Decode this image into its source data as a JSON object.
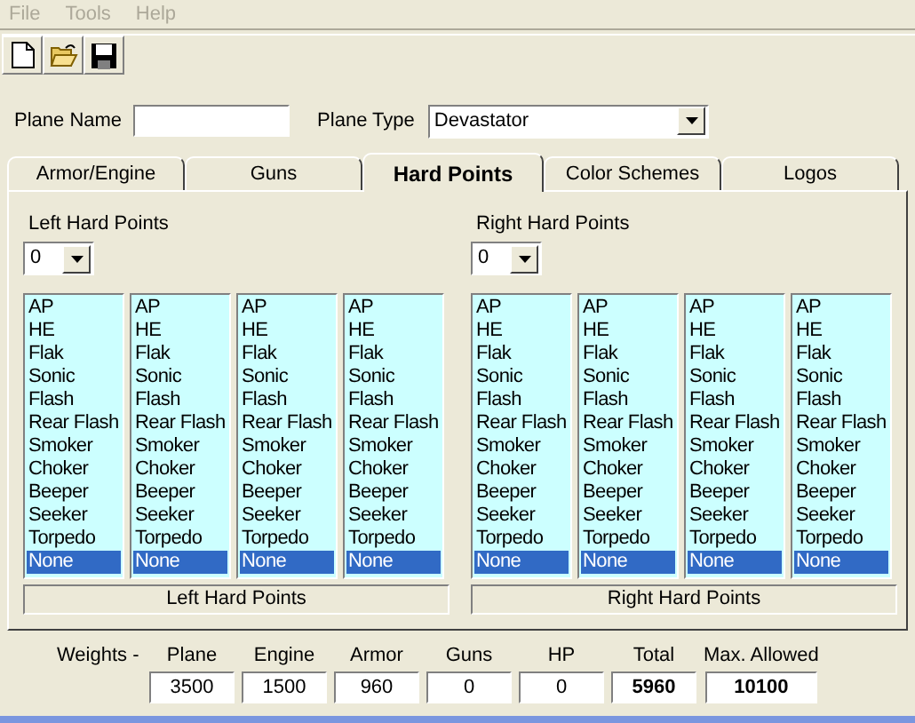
{
  "menu": [
    {
      "label": "File",
      "disabled": true
    },
    {
      "label": "Tools",
      "disabled": true
    },
    {
      "label": "Help",
      "disabled": true
    }
  ],
  "plane_name": {
    "label": "Plane Name"
  },
  "plane_type": {
    "label": "Plane Type",
    "value": "Devastator"
  },
  "tabs": [
    {
      "label": "Armor/Engine",
      "selected": false
    },
    {
      "label": "Guns",
      "selected": false
    },
    {
      "label": "Hard Points",
      "selected": true
    },
    {
      "label": "Color Schemes",
      "selected": false
    },
    {
      "label": "Logos",
      "selected": false
    }
  ],
  "hard_point_groups": [
    {
      "title": "Left Hard Points",
      "count": "0",
      "caption": "Left Hard Points",
      "lists": [
        {
          "items": [
            {
              "label": "AP",
              "selected": false
            },
            {
              "label": "HE",
              "selected": false
            },
            {
              "label": "Flak",
              "selected": false
            },
            {
              "label": "Sonic",
              "selected": false
            },
            {
              "label": "Flash",
              "selected": false
            },
            {
              "label": "Rear Flash",
              "selected": false
            },
            {
              "label": "Smoker",
              "selected": false
            },
            {
              "label": "Choker",
              "selected": false
            },
            {
              "label": "Beeper",
              "selected": false
            },
            {
              "label": "Seeker",
              "selected": false
            },
            {
              "label": "Torpedo",
              "selected": false
            },
            {
              "label": "None",
              "selected": true
            }
          ]
        },
        {
          "items": [
            {
              "label": "AP",
              "selected": false
            },
            {
              "label": "HE",
              "selected": false
            },
            {
              "label": "Flak",
              "selected": false
            },
            {
              "label": "Sonic",
              "selected": false
            },
            {
              "label": "Flash",
              "selected": false
            },
            {
              "label": "Rear Flash",
              "selected": false
            },
            {
              "label": "Smoker",
              "selected": false
            },
            {
              "label": "Choker",
              "selected": false
            },
            {
              "label": "Beeper",
              "selected": false
            },
            {
              "label": "Seeker",
              "selected": false
            },
            {
              "label": "Torpedo",
              "selected": false
            },
            {
              "label": "None",
              "selected": true
            }
          ]
        },
        {
          "items": [
            {
              "label": "AP",
              "selected": false
            },
            {
              "label": "HE",
              "selected": false
            },
            {
              "label": "Flak",
              "selected": false
            },
            {
              "label": "Sonic",
              "selected": false
            },
            {
              "label": "Flash",
              "selected": false
            },
            {
              "label": "Rear Flash",
              "selected": false
            },
            {
              "label": "Smoker",
              "selected": false
            },
            {
              "label": "Choker",
              "selected": false
            },
            {
              "label": "Beeper",
              "selected": false
            },
            {
              "label": "Seeker",
              "selected": false
            },
            {
              "label": "Torpedo",
              "selected": false
            },
            {
              "label": "None",
              "selected": true
            }
          ]
        },
        {
          "items": [
            {
              "label": "AP",
              "selected": false
            },
            {
              "label": "HE",
              "selected": false
            },
            {
              "label": "Flak",
              "selected": false
            },
            {
              "label": "Sonic",
              "selected": false
            },
            {
              "label": "Flash",
              "selected": false
            },
            {
              "label": "Rear Flash",
              "selected": false
            },
            {
              "label": "Smoker",
              "selected": false
            },
            {
              "label": "Choker",
              "selected": false
            },
            {
              "label": "Beeper",
              "selected": false
            },
            {
              "label": "Seeker",
              "selected": false
            },
            {
              "label": "Torpedo",
              "selected": false
            },
            {
              "label": "None",
              "selected": true
            }
          ]
        }
      ]
    },
    {
      "title": "Right Hard Points",
      "count": "0",
      "caption": "Right Hard Points",
      "lists": [
        {
          "items": [
            {
              "label": "AP",
              "selected": false
            },
            {
              "label": "HE",
              "selected": false
            },
            {
              "label": "Flak",
              "selected": false
            },
            {
              "label": "Sonic",
              "selected": false
            },
            {
              "label": "Flash",
              "selected": false
            },
            {
              "label": "Rear Flash",
              "selected": false
            },
            {
              "label": "Smoker",
              "selected": false
            },
            {
              "label": "Choker",
              "selected": false
            },
            {
              "label": "Beeper",
              "selected": false
            },
            {
              "label": "Seeker",
              "selected": false
            },
            {
              "label": "Torpedo",
              "selected": false
            },
            {
              "label": "None",
              "selected": true
            }
          ]
        },
        {
          "items": [
            {
              "label": "AP",
              "selected": false
            },
            {
              "label": "HE",
              "selected": false
            },
            {
              "label": "Flak",
              "selected": false
            },
            {
              "label": "Sonic",
              "selected": false
            },
            {
              "label": "Flash",
              "selected": false
            },
            {
              "label": "Rear Flash",
              "selected": false
            },
            {
              "label": "Smoker",
              "selected": false
            },
            {
              "label": "Choker",
              "selected": false
            },
            {
              "label": "Beeper",
              "selected": false
            },
            {
              "label": "Seeker",
              "selected": false
            },
            {
              "label": "Torpedo",
              "selected": false
            },
            {
              "label": "None",
              "selected": true
            }
          ]
        },
        {
          "items": [
            {
              "label": "AP",
              "selected": false
            },
            {
              "label": "HE",
              "selected": false
            },
            {
              "label": "Flak",
              "selected": false
            },
            {
              "label": "Sonic",
              "selected": false
            },
            {
              "label": "Flash",
              "selected": false
            },
            {
              "label": "Rear Flash",
              "selected": false
            },
            {
              "label": "Smoker",
              "selected": false
            },
            {
              "label": "Choker",
              "selected": false
            },
            {
              "label": "Beeper",
              "selected": false
            },
            {
              "label": "Seeker",
              "selected": false
            },
            {
              "label": "Torpedo",
              "selected": false
            },
            {
              "label": "None",
              "selected": true
            }
          ]
        },
        {
          "items": [
            {
              "label": "AP",
              "selected": false
            },
            {
              "label": "HE",
              "selected": false
            },
            {
              "label": "Flak",
              "selected": false
            },
            {
              "label": "Sonic",
              "selected": false
            },
            {
              "label": "Flash",
              "selected": false
            },
            {
              "label": "Rear Flash",
              "selected": false
            },
            {
              "label": "Smoker",
              "selected": false
            },
            {
              "label": "Choker",
              "selected": false
            },
            {
              "label": "Beeper",
              "selected": false
            },
            {
              "label": "Seeker",
              "selected": false
            },
            {
              "label": "Torpedo",
              "selected": false
            },
            {
              "label": "None",
              "selected": true
            }
          ]
        }
      ]
    }
  ],
  "weights": {
    "label": "Weights -",
    "fields": [
      {
        "label": "Plane",
        "value": "3500",
        "bold": false
      },
      {
        "label": "Engine",
        "value": "1500",
        "bold": false
      },
      {
        "label": "Armor",
        "value": "960",
        "bold": false
      },
      {
        "label": "Guns",
        "value": "0",
        "bold": false
      },
      {
        "label": "HP",
        "value": "0",
        "bold": false
      },
      {
        "label": "Total",
        "value": "5960",
        "bold": true
      },
      {
        "label": "Max. Allowed",
        "value": "10100",
        "bold": true
      }
    ]
  }
}
